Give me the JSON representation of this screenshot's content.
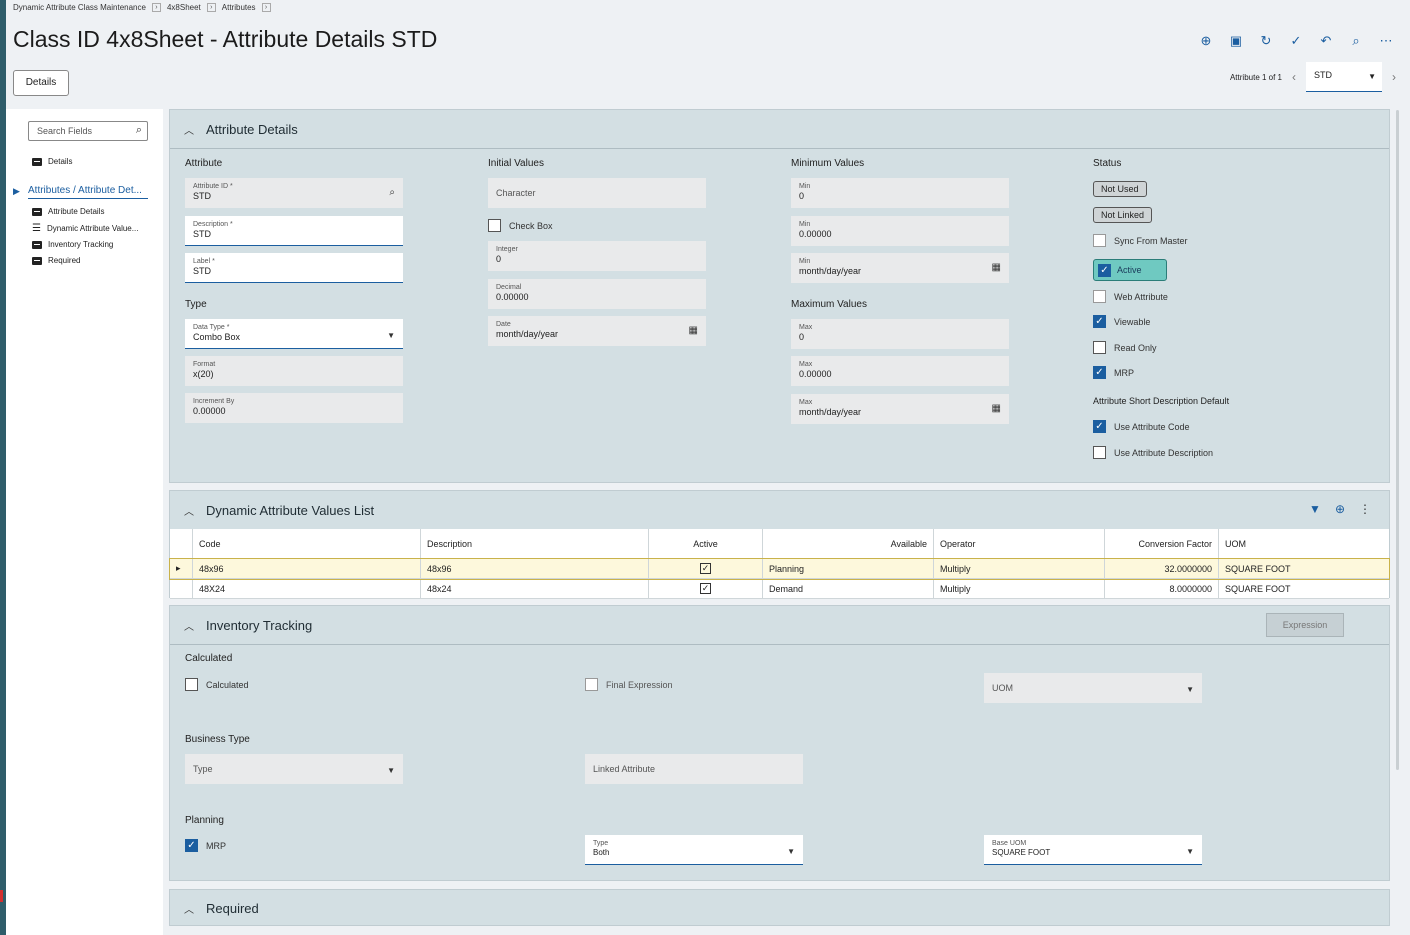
{
  "breadcrumb": [
    "Dynamic Attribute Class Maintenance",
    "4x8Sheet",
    "Attributes"
  ],
  "title": "Class ID 4x8Sheet - Attribute Details STD",
  "toolbar_icons": [
    "add-icon",
    "save-icon",
    "refresh-icon",
    "clear-icon",
    "undo-icon",
    "search-icon",
    "more-icon"
  ],
  "details_button": "Details",
  "pager": {
    "text": "Attribute 1 of 1",
    "selected": "STD"
  },
  "sidebar": {
    "search_placeholder": "Search Fields",
    "top_item": "Details",
    "active_group": "Attributes / Attribute Det...",
    "items": [
      "Attribute Details",
      "Dynamic Attribute Value...",
      "Inventory Tracking",
      "Required"
    ]
  },
  "attr_details": {
    "title": "Attribute Details",
    "attribute_header": "Attribute",
    "attribute_id_label": "Attribute ID *",
    "attribute_id": "STD",
    "description_label": "Description *",
    "description": "STD",
    "label_label": "Label *",
    "label": "STD",
    "type_header": "Type",
    "data_type_label": "Data Type *",
    "data_type": "Combo Box",
    "format_label": "Format",
    "format": "x(20)",
    "increment_label": "Increment By",
    "increment": "0.00000",
    "initial_header": "Initial Values",
    "character_placeholder": "Character",
    "checkbox_label": "Check Box",
    "integer_label": "Integer",
    "integer": "0",
    "decimal_label": "Decimal",
    "decimal": "0.00000",
    "date_label": "Date",
    "date_placeholder": "month/day/year",
    "min_header": "Minimum Values",
    "min_label": "Min",
    "min_int": "0",
    "min_dec": "0.00000",
    "min_date": "month/day/year",
    "max_header": "Maximum Values",
    "max_label": "Max",
    "max_int": "0",
    "max_dec": "0.00000",
    "max_date": "month/day/year",
    "status_header": "Status",
    "not_used": "Not Used",
    "not_linked": "Not Linked",
    "sync_from_master": "Sync From Master",
    "active": "Active",
    "web_attribute": "Web Attribute",
    "viewable": "Viewable",
    "read_only": "Read Only",
    "mrp": "MRP",
    "short_desc_header": "Attribute Short Description Default",
    "use_code": "Use Attribute Code",
    "use_description": "Use Attribute Description"
  },
  "values_list": {
    "title": "Dynamic Attribute Values List",
    "columns": [
      "Code",
      "Description",
      "Active",
      "Available",
      "Operator",
      "Conversion Factor",
      "UOM"
    ],
    "rows": [
      {
        "code": "48x96",
        "description": "48x96",
        "available": "Planning",
        "operator": "Multiply",
        "factor": "32.0000000",
        "uom": "SQUARE FOOT"
      },
      {
        "code": "48X24",
        "description": "48x24",
        "available": "Demand",
        "operator": "Multiply",
        "factor": "8.0000000",
        "uom": "SQUARE FOOT"
      }
    ]
  },
  "inventory": {
    "title": "Inventory Tracking",
    "expression_button": "Expression",
    "calculated_header": "Calculated",
    "calculated": "Calculated",
    "final_expression": "Final Expression",
    "uom_placeholder": "UOM",
    "business_header": "Business Type",
    "type_placeholder": "Type",
    "linked_placeholder": "Linked Attribute",
    "planning_header": "Planning",
    "mrp": "MRP",
    "type_label": "Type",
    "type_value": "Both",
    "base_uom_label": "Base UOM",
    "base_uom": "SQUARE FOOT"
  },
  "required": {
    "title": "Required"
  },
  "colors": {
    "accent": "#1b5ea0",
    "section_bg": "#d3dfe3",
    "active_teal": "#6fc9c1",
    "selected_row": "#fdf8dc"
  }
}
